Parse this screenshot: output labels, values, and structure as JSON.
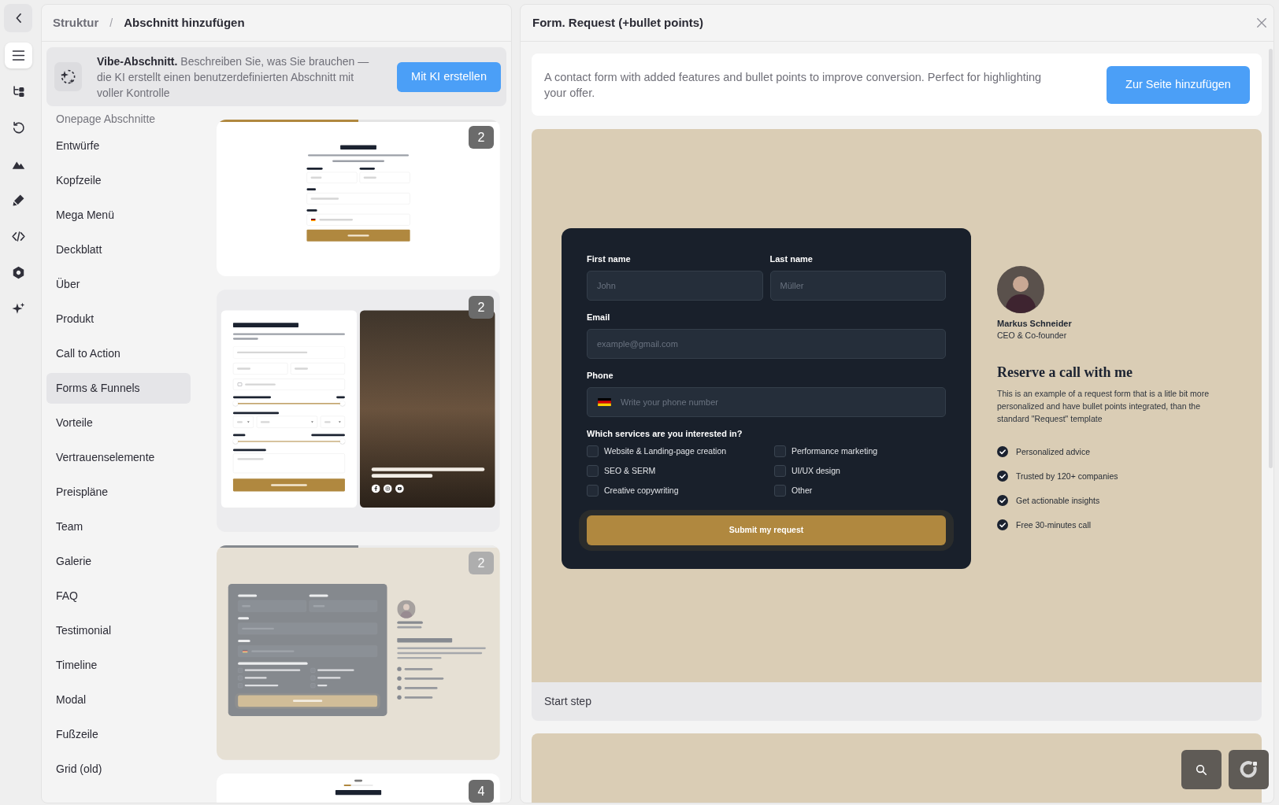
{
  "rail": {
    "items": [
      {
        "kind": "menu",
        "selected": true
      },
      {
        "kind": "tree",
        "selected": false
      },
      {
        "kind": "history",
        "selected": false
      },
      {
        "kind": "image",
        "selected": false
      },
      {
        "kind": "pen",
        "selected": false
      },
      {
        "kind": "code",
        "selected": false
      },
      {
        "kind": "settings",
        "selected": false
      },
      {
        "kind": "sparkles",
        "selected": false
      }
    ]
  },
  "left_panel": {
    "breadcrumb": {
      "parent": "Struktur",
      "separator": "/",
      "current": "Abschnitt hinzufügen"
    },
    "vibe_banner": {
      "text": "**Vibe-Abschnitt.** Beschreiben Sie, was Sie brauchen — die KI erstellt einen benutzerdefinierten Abschnitt mit voller Kontrolle",
      "button": "Mit KI erstellen"
    },
    "categories": {
      "heading": "Onepage Abschnitte",
      "items": [
        {
          "label": "Entwürfe",
          "selected": false
        },
        {
          "label": "Kopfzeile",
          "selected": false
        },
        {
          "label": "Mega Menü",
          "selected": false
        },
        {
          "label": "Deckblatt",
          "selected": false
        },
        {
          "label": "Über",
          "selected": false
        },
        {
          "label": "Produkt",
          "selected": false
        },
        {
          "label": "Call to Action",
          "selected": false
        },
        {
          "label": "Forms & Funnels",
          "selected": true
        },
        {
          "label": "Vorteile",
          "selected": false
        },
        {
          "label": "Vertrauenselemente",
          "selected": false
        },
        {
          "label": "Preispläne",
          "selected": false
        },
        {
          "label": "Team",
          "selected": false
        },
        {
          "label": "Galerie",
          "selected": false
        },
        {
          "label": "FAQ",
          "selected": false
        },
        {
          "label": "Testimonial",
          "selected": false
        },
        {
          "label": "Timeline",
          "selected": false
        },
        {
          "label": "Modal",
          "selected": false
        },
        {
          "label": "Fußzeile",
          "selected": false
        },
        {
          "label": "Grid (old)",
          "selected": false
        }
      ]
    },
    "templates": [
      {
        "kind": "contact",
        "badge": "2",
        "selected": false,
        "level": 0.5
      },
      {
        "kind": "event",
        "badge": "2",
        "selected": false
      },
      {
        "kind": "request",
        "badge": "2",
        "selected": true,
        "level": 0.5
      },
      {
        "kind": "steps",
        "badge": "4",
        "selected": false,
        "level": 0.25
      }
    ]
  },
  "right_panel": {
    "title": "Form. Request (+bullet points)",
    "description": "A contact form with added features and bullet points to improve conversion. Perfect for highlighting your offer.",
    "button": "Zur Seite hinzufügen",
    "preview": {
      "fields": [
        {
          "kind": "text",
          "label": "First name",
          "placeholder": "John"
        },
        {
          "kind": "text",
          "label": "Last name",
          "placeholder": "Müller"
        },
        {
          "kind": "text",
          "label": "Email",
          "placeholder": "example@gmail.com"
        },
        {
          "kind": "phone",
          "label": "Phone",
          "placeholder": "Write your phone number"
        }
      ],
      "services": {
        "label": "Which services are you interested in?",
        "options": [
          {
            "label": "Website & Landing-page creation",
            "checked": false
          },
          {
            "label": "Performance marketing",
            "checked": false
          },
          {
            "label": "SEO & SERM",
            "checked": false
          },
          {
            "label": "UI/UX design",
            "checked": false
          },
          {
            "label": "Creative copywriting",
            "checked": false
          },
          {
            "label": "Other",
            "checked": false
          }
        ]
      },
      "button": "Submit my request",
      "person": {
        "name": "Markus Schneider",
        "role": "CEO & Co-founder"
      },
      "heading": "Reserve a call with me",
      "text": "This is an example of a request form that is a litle bit more personalized and have bullet points integrated, than the standard \"Request\" template",
      "bullets": [
        "Personalized advice",
        "Trusted by 120+ companies",
        "Get actionable insights",
        "Free 30-minutes call"
      ]
    },
    "step_label": "Start step"
  }
}
